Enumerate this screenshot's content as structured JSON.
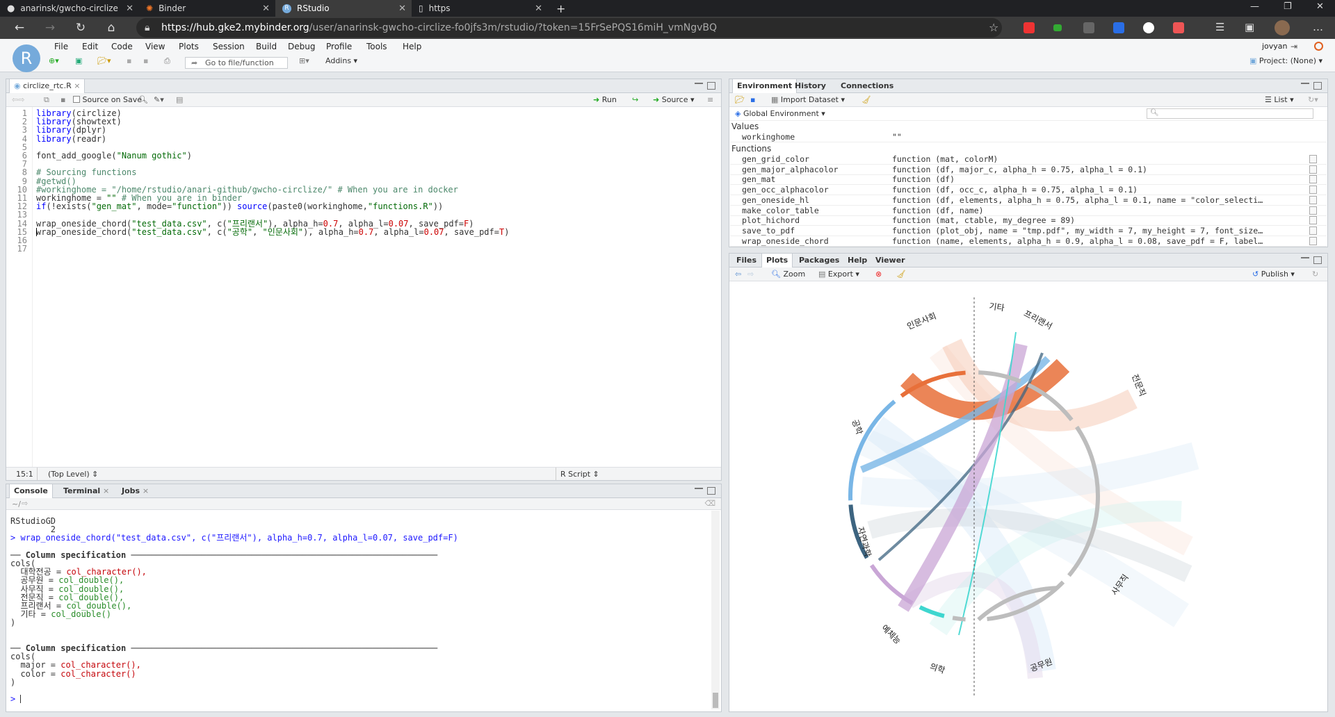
{
  "browser": {
    "tabs": [
      {
        "label": "anarinsk/gwcho-circlize"
      },
      {
        "label": "Binder"
      },
      {
        "label": "RStudio"
      },
      {
        "label": "https"
      }
    ],
    "url_host": "https://hub.gke2.mybinder.org",
    "url_path": "/user/anarinsk-gwcho-circlize-fo0jfs3m/rstudio/?token=15FrSePQS16miH_vmNgvBQ"
  },
  "menu": [
    "File",
    "Edit",
    "Code",
    "View",
    "Plots",
    "Session",
    "Build",
    "Debug",
    "Profile",
    "Tools",
    "Help"
  ],
  "user": "jovyan",
  "toolbar": {
    "goto_placeholder": "Go to file/function",
    "addins": "Addins",
    "project": "Project: (None)"
  },
  "editor": {
    "tab": "circlize_rtc.R",
    "source_on_save": "Source on Save",
    "run": "Run",
    "source": "Source",
    "status_pos": "15:1",
    "status_level": "(Top Level)",
    "status_type": "R Script",
    "line_numbers": [
      "1",
      "2",
      "3",
      "4",
      "5",
      "6",
      "7",
      "8",
      "9",
      "10",
      "11",
      "12",
      "13",
      "14",
      "15",
      "16",
      "17"
    ]
  },
  "console": {
    "tabs": [
      "Console",
      "Terminal",
      "Jobs"
    ],
    "path": "~/",
    "lines": [
      "RStudioGD",
      "        2"
    ],
    "cmd": "wrap_oneside_chord(\"test_data.csv\", c(\"프리랜서\"), alpha_h=0.7, alpha_l=0.07, save_pdf=F)",
    "spec_title": "Column specification",
    "spec1": [
      [
        "대학전공",
        "col_character(),"
      ],
      [
        "공무원",
        "col_double(),"
      ],
      [
        "사무직",
        "col_double(),"
      ],
      [
        "전문직",
        "col_double(),"
      ],
      [
        "프리랜서",
        "col_double(),"
      ],
      [
        "기타",
        "col_double()"
      ]
    ],
    "spec2": [
      [
        "major",
        "col_character(),"
      ],
      [
        "color",
        "col_character()"
      ]
    ]
  },
  "environment": {
    "tabs": [
      "Environment",
      "History",
      "Connections"
    ],
    "import": "Import Dataset",
    "list": "List",
    "scope": "Global Environment",
    "values_title": "Values",
    "functions_title": "Functions",
    "values": [
      {
        "name": "workinghome",
        "value": "\"\""
      }
    ],
    "functions": [
      {
        "name": "gen_grid_color",
        "value": "function (mat, colorM)"
      },
      {
        "name": "gen_major_alphacolor",
        "value": "function (df, major_c, alpha_h = 0.75, alpha_l = 0.1)"
      },
      {
        "name": "gen_mat",
        "value": "function (df)"
      },
      {
        "name": "gen_occ_alphacolor",
        "value": "function (df, occ_c, alpha_h = 0.75, alpha_l = 0.1)"
      },
      {
        "name": "gen_oneside_hl",
        "value": "function (df, elements, alpha_h = 0.75, alpha_l = 0.1, name = \"color_selecti…"
      },
      {
        "name": "make_color_table",
        "value": "function (df, name)"
      },
      {
        "name": "plot_hichord",
        "value": "function (mat, ctable, my_degree = 89)"
      },
      {
        "name": "save_to_pdf",
        "value": "function (plot_obj, name = \"tmp.pdf\", my_width = 7, my_height = 7, font_size…"
      },
      {
        "name": "wrap_oneside_chord",
        "value": "function (name, elements, alpha_h = 0.9, alpha_l = 0.08, save_pdf = F, label…"
      }
    ]
  },
  "plots": {
    "tabs": [
      "Files",
      "Plots",
      "Packages",
      "Help",
      "Viewer"
    ],
    "zoom": "Zoom",
    "export": "Export",
    "publish": "Publish",
    "labels": [
      "기타",
      "프리랜서",
      "전문직",
      "사무직",
      "공무원",
      "의학",
      "예체능",
      "자연과학",
      "공학",
      "인문사회"
    ],
    "colors": {
      "인문사회": "#e8703a",
      "공학": "#79b6e6",
      "자연과학": "#3d6480",
      "예체능": "#c9a6d6",
      "의학": "#3fd6cf",
      "occupations": "#bdbdbd"
    }
  }
}
